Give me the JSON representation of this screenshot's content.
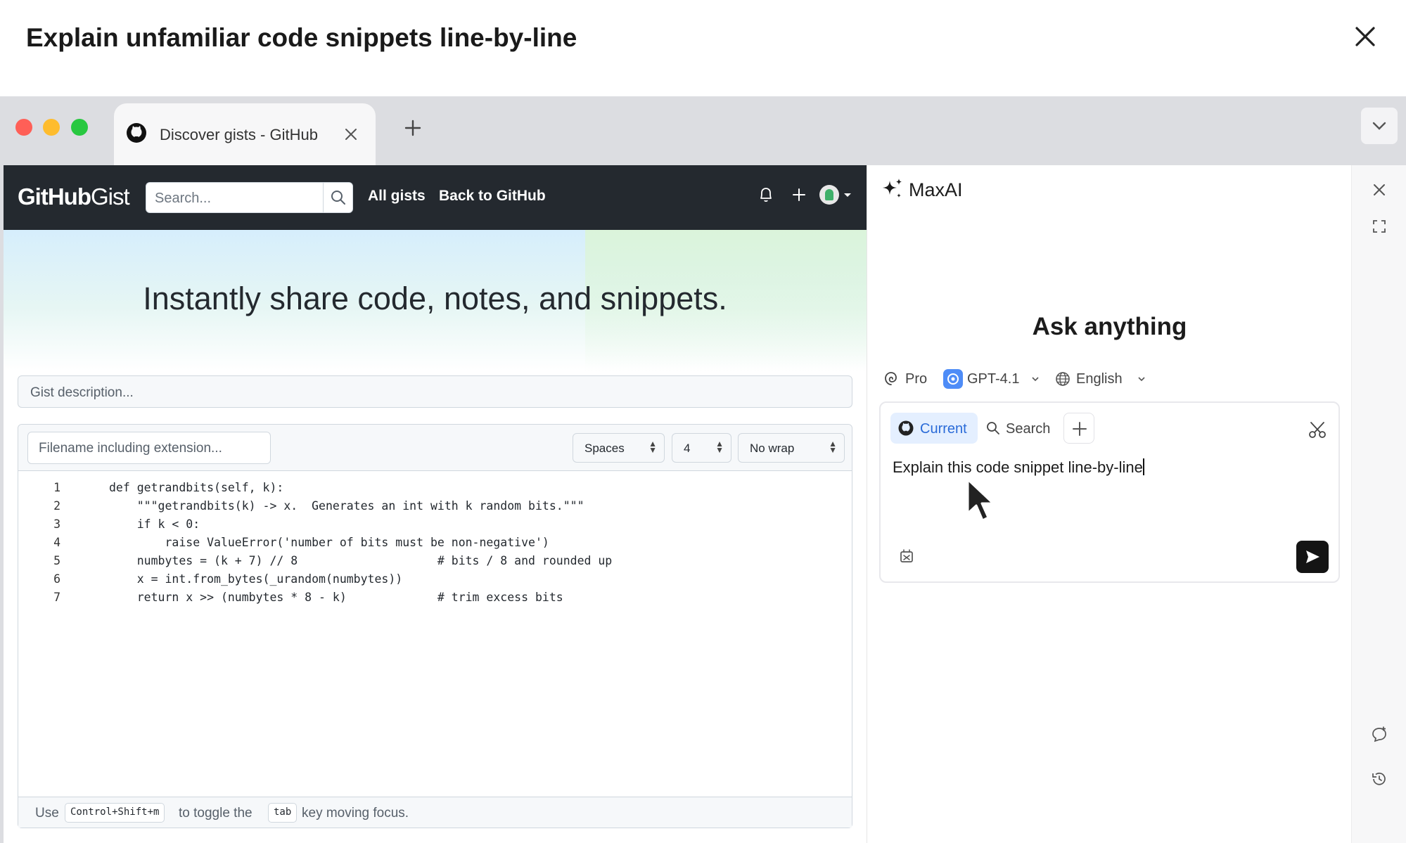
{
  "modal": {
    "title": "Explain unfamiliar code snippets line-by-line",
    "close_icon": "close-icon"
  },
  "browser": {
    "tab": {
      "title": "Discover gists - GitHub",
      "icon": "github-icon"
    },
    "new_tab_icon": "plus-icon",
    "tabs_dropdown_icon": "chevron-down-icon",
    "traffic_lights": [
      "#ff5f57",
      "#febc2e",
      "#28c840"
    ]
  },
  "gist": {
    "logo_bold": "GitHub",
    "logo_light": "Gist",
    "search_placeholder": "Search...",
    "nav_links": [
      "All gists",
      "Back to GitHub"
    ],
    "hero": "Instantly share code, notes, and snippets.",
    "description_placeholder": "Gist description...",
    "filename_placeholder": "Filename including extension...",
    "indent_mode": "Spaces",
    "indent_size": "4",
    "wrap_mode": "No wrap",
    "code_lines": [
      {
        "n": "1",
        "text": "def getrandbits(self, k):"
      },
      {
        "n": "2",
        "text": "    \"\"\"getrandbits(k) -> x.  Generates an int with k random bits.\"\"\""
      },
      {
        "n": "3",
        "text": "    if k < 0:"
      },
      {
        "n": "4",
        "text": "        raise ValueError('number of bits must be non-negative')"
      },
      {
        "n": "5",
        "text": "    numbytes = (k + 7) // 8                    # bits / 8 and rounded up"
      },
      {
        "n": "6",
        "text": "    x = int.from_bytes(_urandom(numbytes))"
      },
      {
        "n": "7",
        "text": "    return x >> (numbytes * 8 - k)             # trim excess bits"
      }
    ],
    "footer": {
      "use": "Use",
      "key_combo": "Control+Shift+m",
      "to_toggle": "to toggle the",
      "tab_key": "tab",
      "rest": "key moving focus."
    },
    "nav_bg": "#24292f"
  },
  "maxai": {
    "name": "MaxAI",
    "heading": "Ask anything",
    "plan": "Pro",
    "model": "GPT-4.1",
    "language": "English",
    "context_current": "Current",
    "context_search": "Search",
    "prompt_text": "Explain this code snippet line-by-line",
    "accent": "#2a6bd8"
  }
}
